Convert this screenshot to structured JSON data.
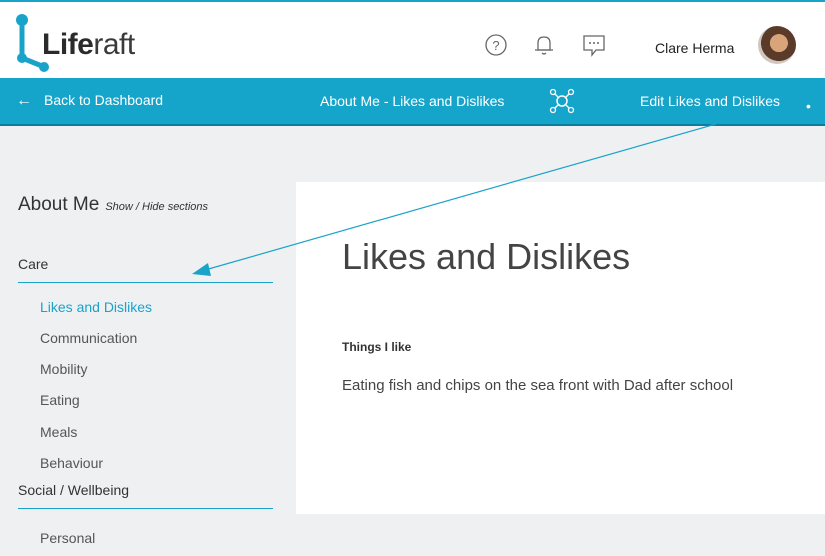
{
  "app": {
    "logo_bold": "Life",
    "logo_light": "raft",
    "accent_color": "#1aa3c9"
  },
  "topbar": {
    "icons": [
      "help-icon",
      "bell-icon",
      "chat-icon"
    ],
    "user_name": "Clare Herma"
  },
  "navbar": {
    "back_label": "Back to Dashboard",
    "center_title": "About Me - Likes and Dislikes",
    "edit_label": "Edit Likes and Dislikes"
  },
  "sidebar": {
    "title": "About Me",
    "toggle_label": "Show / Hide sections",
    "sections": [
      {
        "label": "Care",
        "items": [
          "Likes and Dislikes",
          "Communication",
          "Mobility",
          "Eating",
          "Meals",
          "Behaviour"
        ]
      },
      {
        "label": "Social / Wellbeing",
        "items": [
          "Personal"
        ]
      }
    ],
    "active_item": "Likes and Dislikes"
  },
  "main": {
    "heading": "Likes and Dislikes",
    "field_label": "Things I like",
    "field_value": "Eating fish and chips on the sea front with Dad after school"
  }
}
